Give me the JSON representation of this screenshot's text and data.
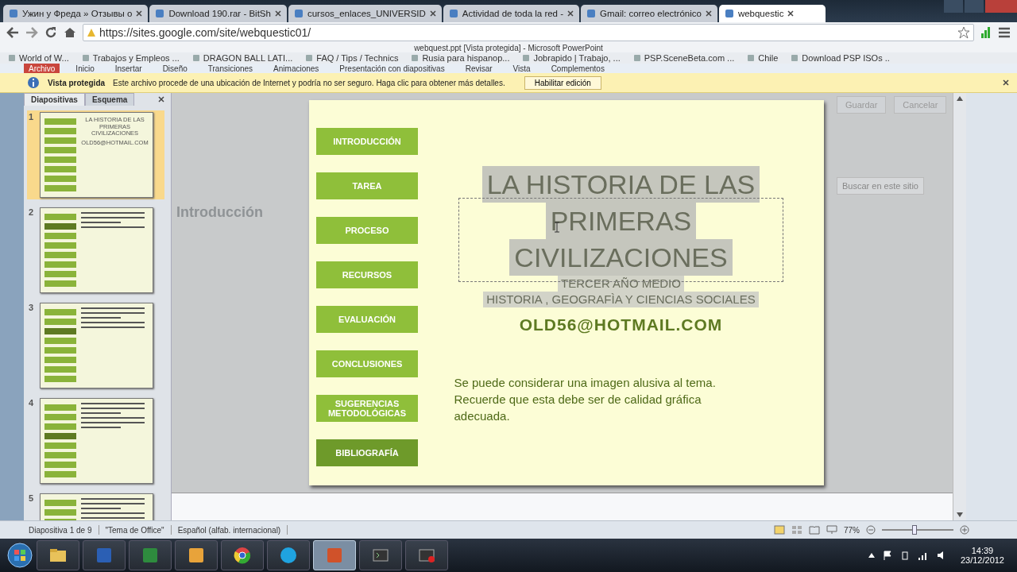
{
  "browser": {
    "tabs": [
      {
        "label": "Ужин у Фреда » Отзывы о",
        "selected": false
      },
      {
        "label": "Download 190.rar - BitSh",
        "selected": false
      },
      {
        "label": "cursos_enlaces_UNIVERSID",
        "selected": false
      },
      {
        "label": "Actividad de toda la red -",
        "selected": false
      },
      {
        "label": "Gmail: correo electrónico",
        "selected": false
      },
      {
        "label": "webquestic",
        "selected": true
      }
    ],
    "url": "https://sites.google.com/site/webquestic01/",
    "bookmarks": [
      "World of W...",
      "Trabajos y Empleos ...",
      "DRAGON BALL LATI...",
      "FAQ / Tips / Technics",
      "Rusia para hispanop...",
      "Jobrapido | Trabajo, ...",
      "PSP.SceneBeta.com ...",
      "Chile",
      "Download PSP ISOs .."
    ]
  },
  "powerpoint": {
    "title": "webquest.ppt [Vista protegida]  -  Microsoft PowerPoint",
    "ribbon_tabs": [
      {
        "label": "Archivo",
        "selected": true
      },
      {
        "label": "Inicio",
        "selected": false
      },
      {
        "label": "Insertar",
        "selected": false
      },
      {
        "label": "Diseño",
        "selected": false
      },
      {
        "label": "Transiciones",
        "selected": false
      },
      {
        "label": "Animaciones",
        "selected": false
      },
      {
        "label": "Presentación con diapositivas",
        "selected": false
      },
      {
        "label": "Revisar",
        "selected": false
      },
      {
        "label": "Vista",
        "selected": false
      },
      {
        "label": "Complementos",
        "selected": false
      }
    ],
    "message_bar": {
      "title": "Vista protegida",
      "message": "Este archivo procede de una ubicación de Internet y podría no ser seguro. Haga clic para obtener más detalles.",
      "button": "Habilitar edición"
    },
    "pane_tabs": [
      {
        "label": "Diapositivas",
        "selected": true
      },
      {
        "label": "Esquema",
        "selected": false
      }
    ],
    "thumbnails": [
      {
        "number": "1",
        "selected": true,
        "title_lines": [
          "LA HISTORIA DE LAS",
          "PRIMERAS",
          "CIVILIZACIONES"
        ],
        "email": "OLD56@HOTMAIL.COM"
      },
      {
        "number": "2",
        "selected": false
      },
      {
        "number": "3",
        "selected": false
      },
      {
        "number": "4",
        "selected": false
      },
      {
        "number": "5",
        "selected": false
      }
    ],
    "slide": {
      "nav_buttons": [
        "INTRODUCCIÓN",
        "TAREA",
        "PROCESO",
        "RECURSOS",
        "EVALUACIÓN",
        "CONCLUSIONES",
        "SUGERENCIAS METODOLÓGICAS",
        "BIBLIOGRAFÍA"
      ],
      "title_lines": [
        "LA HISTORIA DE LAS",
        "PRIMERAS",
        "CIVILIZACIONES"
      ],
      "subtitle_lines": [
        "TERCER AÑO MEDIO",
        "HISTORIA , GEOGRAFÌA Y CIENCIAS SOCIALES"
      ],
      "email": "OLD56@HOTMAIL.COM",
      "note": "Se puede considerar una imagen alusiva al tema.  Recuerde que esta debe ser de calidad gráfica adecuada."
    },
    "status_bar": {
      "slide_info": "Diapositiva 1 de 9",
      "theme": "\"Tema de Office\"",
      "language": "Español (alfab. internacional)",
      "zoom": "77%",
      "zoom_slider": {
        "level": 0.45
      }
    }
  },
  "background_site": {
    "page_heading": "Introducción",
    "buttons": [
      "Guardar",
      "Cancelar"
    ],
    "search_placeholder": "Buscar en este sitio"
  },
  "taskbar": {
    "apps": [
      {
        "kind": "folder",
        "selected": false
      },
      {
        "kind": "word",
        "selected": false
      },
      {
        "kind": "excel",
        "selected": false
      },
      {
        "kind": "outlook",
        "selected": false
      },
      {
        "kind": "chrome",
        "selected": false
      },
      {
        "kind": "skype",
        "selected": false
      },
      {
        "kind": "powerpoint",
        "selected": true
      },
      {
        "kind": "terminal",
        "selected": false
      },
      {
        "kind": "terminal-record",
        "selected": false
      }
    ],
    "time": "14:39",
    "date": "23/12/2012"
  }
}
